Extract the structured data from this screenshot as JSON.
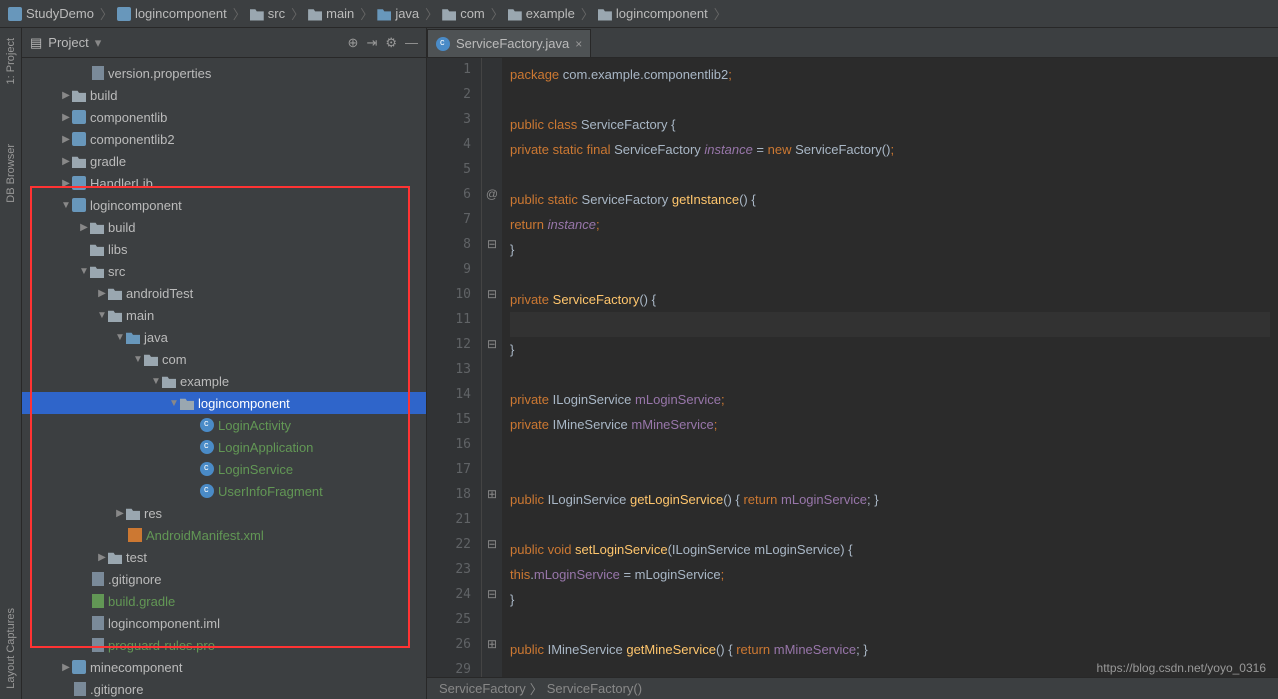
{
  "breadcrumbs": [
    "StudyDemo",
    "logincomponent",
    "src",
    "main",
    "java",
    "com",
    "example",
    "logincomponent"
  ],
  "panel": {
    "title": "Project"
  },
  "tree": {
    "version_properties": "version.properties",
    "build": "build",
    "componentlib": "componentlib",
    "componentlib2": "componentlib2",
    "gradle": "gradle",
    "handlerlib": "HandlerLib",
    "logincomponent": "logincomponent",
    "lc_build": "build",
    "lc_libs": "libs",
    "lc_src": "src",
    "lc_androidtest": "androidTest",
    "lc_main": "main",
    "lc_java": "java",
    "lc_com": "com",
    "lc_example": "example",
    "lc_pkg": "logincomponent",
    "loginactivity": "LoginActivity",
    "loginapplication": "LoginApplication",
    "loginservice": "LoginService",
    "userinfofragment": "UserInfoFragment",
    "lc_res": "res",
    "manifest": "AndroidManifest.xml",
    "lc_test": "test",
    "gitignore": ".gitignore",
    "buildgradle": "build.gradle",
    "lc_iml": "logincomponent.iml",
    "proguard": "proguard-rules.pro",
    "minecomponent": "minecomponent",
    "gitignore2": ".gitignore"
  },
  "tab": {
    "name": "ServiceFactory.java"
  },
  "gutter_left": {
    "project": "1: Project",
    "db": "DB Browser",
    "layout": "Layout Captures"
  },
  "line_numbers": [
    1,
    2,
    3,
    4,
    5,
    6,
    7,
    8,
    9,
    10,
    11,
    12,
    13,
    14,
    15,
    16,
    17,
    18,
    21,
    22,
    23,
    24,
    25,
    26,
    29
  ],
  "bottom": {
    "a": "ServiceFactory",
    "b": "ServiceFactory()"
  },
  "watermark": "https://blog.csdn.net/yoyo_0316",
  "code": {
    "l1": {
      "kw": "package",
      "rest": " com.example.componentlib2"
    },
    "l3": {
      "pub": "public",
      "cls": " class",
      "name": " ServiceFactory ",
      "brace": "{"
    },
    "l4": {
      "priv": "private",
      "stat": " static",
      "fin": " final",
      "typ": " ServiceFactory ",
      "fld": "instance",
      "eq": " = ",
      "nw": "new",
      "ctor": " ServiceFactory()"
    },
    "l6": {
      "pub": "public",
      "stat": " static",
      "typ": " ServiceFactory ",
      "fn": "getInstance",
      "p": "() {"
    },
    "l7": {
      "ret": "return",
      "fld": " instance"
    },
    "l10": {
      "priv": "private",
      "fn": " ServiceFactory",
      "p": "() {"
    },
    "l14": {
      "priv": "private",
      "typ": " ILoginService ",
      "fld": "mLoginService"
    },
    "l15": {
      "priv": "private",
      "typ": " IMineService ",
      "fld": "mMineService"
    },
    "l18": {
      "pub": "public",
      "typ": " ILoginService ",
      "fn": "getLoginService",
      "p": "() { ",
      "ret": "return",
      "fld": " mLoginService",
      "end": "; }"
    },
    "l22": {
      "pub": "public",
      "vd": " void",
      "fn": " setLoginService",
      "p": "(ILoginService mLoginService) {"
    },
    "l23": {
      "ths": "this",
      "dot": ".",
      "fld": "mLoginService",
      "eq": " = mLoginService"
    },
    "l26": {
      "pub": "public",
      "typ": " IMineService ",
      "fn": "getMineService",
      "p": "() { ",
      "ret": "return",
      "fld": " mMineService",
      "end": "; }"
    }
  }
}
